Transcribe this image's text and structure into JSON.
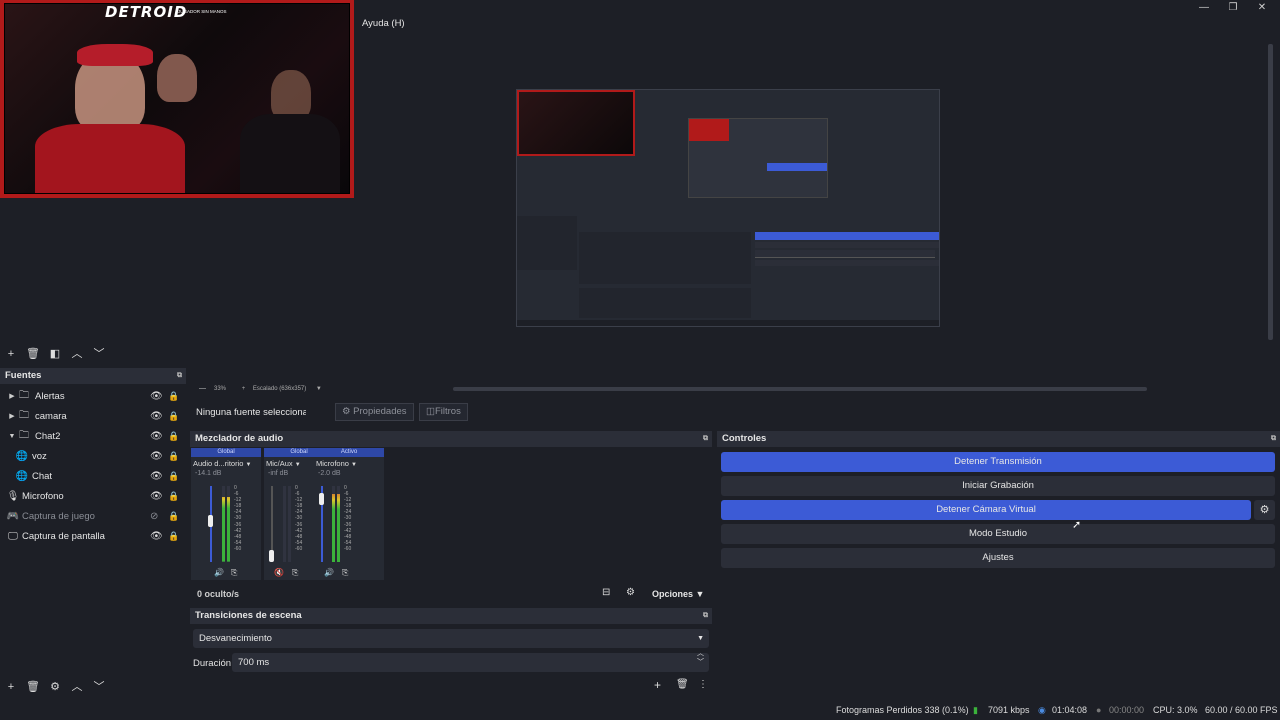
{
  "menu": {
    "help": "Ayuda (H)"
  },
  "webcam": {
    "title": "DETROID",
    "subtitle": "JUGADOR SIN MANOS"
  },
  "preview": {
    "zoom": "33%",
    "scale": "Escalado (636x357)"
  },
  "sources": {
    "title": "Fuentes",
    "items": [
      {
        "label": "Alertas",
        "type": "folder",
        "visible": true
      },
      {
        "label": "camara",
        "type": "folder",
        "visible": true
      },
      {
        "label": "Chat2",
        "type": "folder",
        "visible": true
      },
      {
        "label": "voz",
        "type": "browser",
        "visible": true
      },
      {
        "label": "Chat",
        "type": "browser",
        "visible": true
      },
      {
        "label": "Microfono",
        "type": "mic",
        "visible": true
      },
      {
        "label": "Captura de juego",
        "type": "game",
        "visible": false
      },
      {
        "label": "Captura de pantalla",
        "type": "display",
        "visible": true
      }
    ]
  },
  "source_toolbar": {
    "no_selection": "Ninguna fuente seleccionada",
    "properties": "Propiedades",
    "filters": "Filtros"
  },
  "mixer": {
    "title": "Mezclador de audio",
    "channels": [
      {
        "head": "Global",
        "name": "Audio d...ritorio",
        "db": "-14.1 dB",
        "level": 0.85
      },
      {
        "head": "Global",
        "name": "Mic/Aux",
        "db": "-inf dB",
        "level": 0.0
      },
      {
        "head": "Activo",
        "name": "Microfono",
        "db": "-2.0 dB",
        "level": 0.9
      }
    ],
    "scale": [
      "0",
      "-6",
      "-12",
      "-18",
      "-24",
      "-30",
      "-36",
      "-42",
      "-48",
      "-54",
      "-60"
    ],
    "hidden": "0 oculto/s",
    "options": "Opciones"
  },
  "transitions": {
    "title": "Transiciones de escena",
    "selected": "Desvanecimiento",
    "duration_label": "Duración",
    "duration_value": "700 ms"
  },
  "controls": {
    "title": "Controles",
    "buttons": [
      {
        "label": "Detener Transmisión",
        "active": true
      },
      {
        "label": "Iniciar Grabación",
        "active": false
      },
      {
        "label": "Detener Cámara Virtual",
        "active": true
      },
      {
        "label": "Modo Estudio",
        "active": false
      },
      {
        "label": "Ajustes",
        "active": false
      }
    ]
  },
  "status": {
    "dropped": "Fotogramas Perdidos 338 (0.1%)",
    "bitrate": "7091 kbps",
    "stream_time": "01:04:08",
    "rec_time": "00:00:00",
    "cpu": "CPU: 3.0%",
    "fps": "60.00 / 60.00 FPS"
  },
  "colors": {
    "accent": "#3c5bd6",
    "background": "#1d1f26",
    "panel": "#2b2e38",
    "webcam_border": "#b11a1a"
  }
}
